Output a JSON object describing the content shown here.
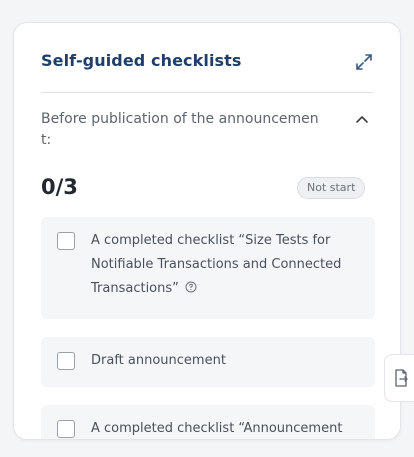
{
  "panel": {
    "title": "Self-guided checklists",
    "expand_icon": "expand-diagonal-icon"
  },
  "section": {
    "title": "Before publication of the announcemen t:",
    "collapse_icon": "chevron-up-icon",
    "progress": "0/3",
    "status": "Not start",
    "items": [
      {
        "label": "A completed checklist “Size Tests for Notifiable Transactions and Connected Transactions”",
        "checked": false,
        "help_icon": "help-circle-icon"
      },
      {
        "label": "Draft announcement",
        "checked": false
      },
      {
        "label": "A completed checklist “Announcement",
        "checked": false
      }
    ]
  },
  "side_tab": {
    "icon": "document-export-icon"
  },
  "colors": {
    "title": "#1f3f6a",
    "item_bg": "#f5f6f8",
    "badge_bg": "#eef0f3"
  }
}
